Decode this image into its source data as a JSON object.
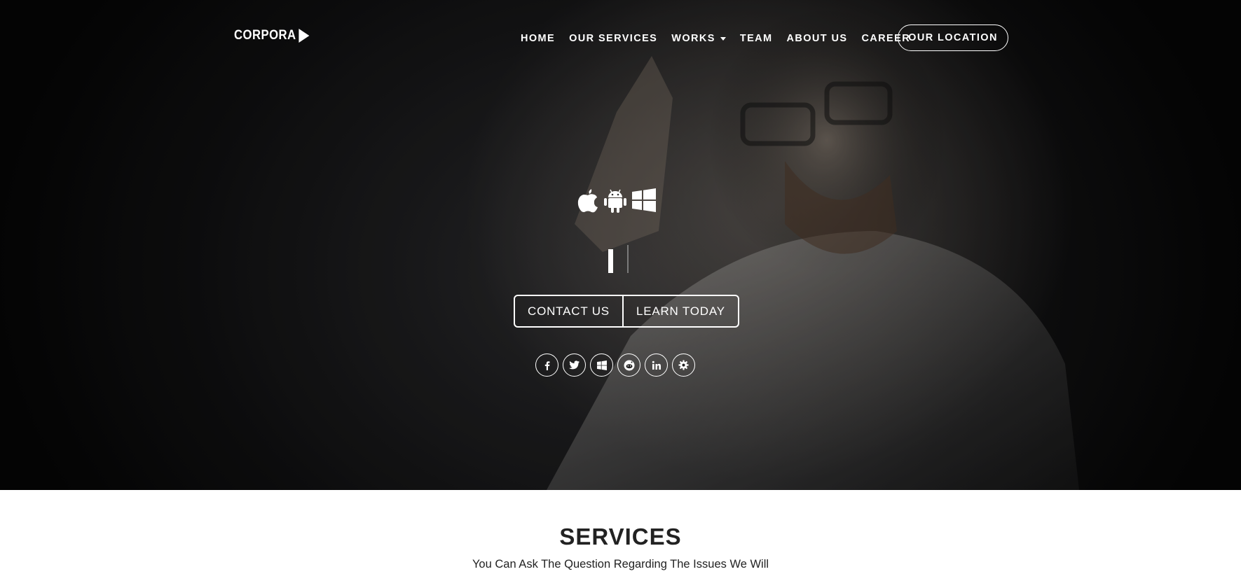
{
  "nav": {
    "logo": "CORPORA",
    "items": [
      {
        "label": "HOME"
      },
      {
        "label": "OUR SERVICES"
      },
      {
        "label": "WORKS"
      },
      {
        "label": "TEAM"
      },
      {
        "label": "ABOUT US"
      },
      {
        "label": "CAREER"
      }
    ],
    "cta": "OUR LOCATION"
  },
  "hero": {
    "platform_icons": [
      "apple-icon",
      "android-icon",
      "windows-icon"
    ],
    "buttons": {
      "contact": "CONTACT US",
      "learn": "LEARN TODAY"
    },
    "social_icons": [
      "facebook-icon",
      "twitter-icon",
      "windows-icon",
      "reddit-icon",
      "linkedin-icon",
      "settings-icon"
    ]
  },
  "services": {
    "title": "SERVICES",
    "subtitle": "You Can Ask The Question Regarding The Issues We Will"
  }
}
